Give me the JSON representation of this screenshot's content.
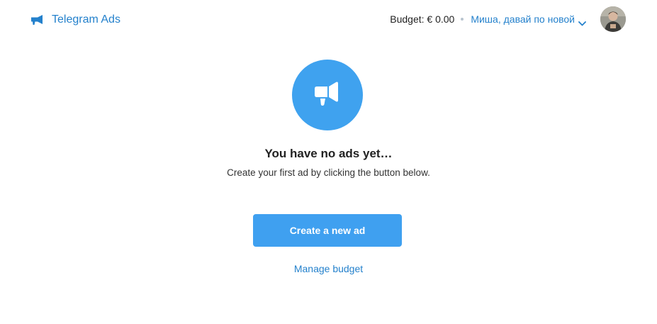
{
  "header": {
    "brand_label": "Telegram Ads",
    "budget_text": "Budget: € 0.00",
    "account_name": "Миша, давай по новой"
  },
  "empty_state": {
    "title": "You have no ads yet…",
    "subtitle": "Create your first ad by clicking the button below."
  },
  "actions": {
    "create_label": "Create a new ad",
    "manage_label": "Manage budget"
  },
  "colors": {
    "accent": "#2481cc",
    "button": "#3fa0f0",
    "circle": "#3fa2ef"
  },
  "icons": {
    "brand": "megaphone-icon",
    "hero": "megaphone-icon",
    "account_menu": "chevron-down-icon"
  }
}
